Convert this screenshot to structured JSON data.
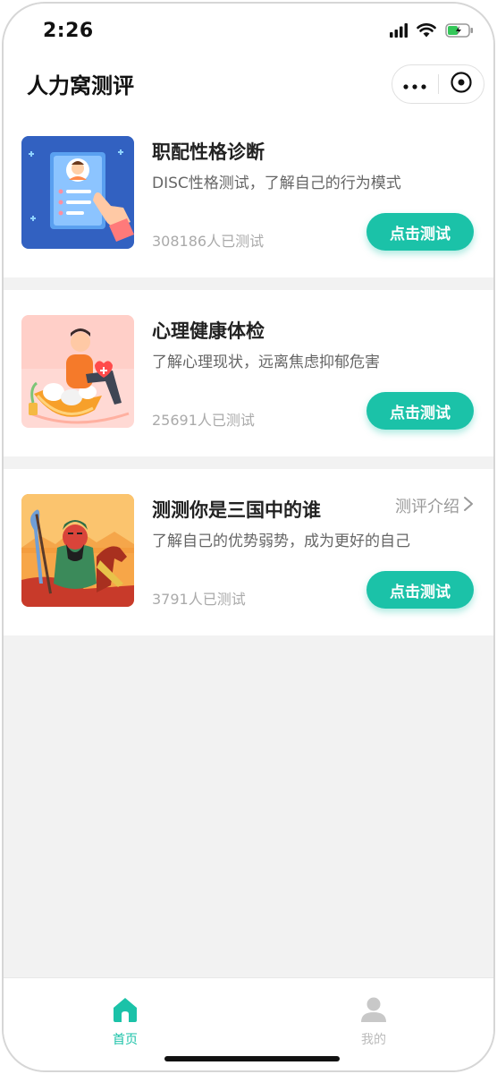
{
  "status": {
    "time": "2:26"
  },
  "nav": {
    "title": "人力窝测评"
  },
  "cards": [
    {
      "title": "职配性格诊断",
      "desc": "DISC性格测试，了解自己的行为模式",
      "count": "308186人已测试",
      "button": "点击测试"
    },
    {
      "title": "心理健康体检",
      "desc": "了解心理现状，远离焦虑抑郁危害",
      "count": "25691人已测试",
      "button": "点击测试"
    },
    {
      "title": "测测你是三国中的谁",
      "desc": "了解自己的优势弱势，成为更好的自己",
      "count": "3791人已测试",
      "button": "点击测试",
      "intro": "测评介绍"
    }
  ],
  "tabs": {
    "home": "首页",
    "mine": "我的"
  },
  "colors": {
    "accent": "#1bc2a8",
    "background": "#f2f2f2"
  },
  "icons": [
    "signal-icon",
    "wifi-icon",
    "battery-icon",
    "more-icon",
    "close-icon",
    "chevron-right-icon",
    "home-icon",
    "user-icon"
  ]
}
